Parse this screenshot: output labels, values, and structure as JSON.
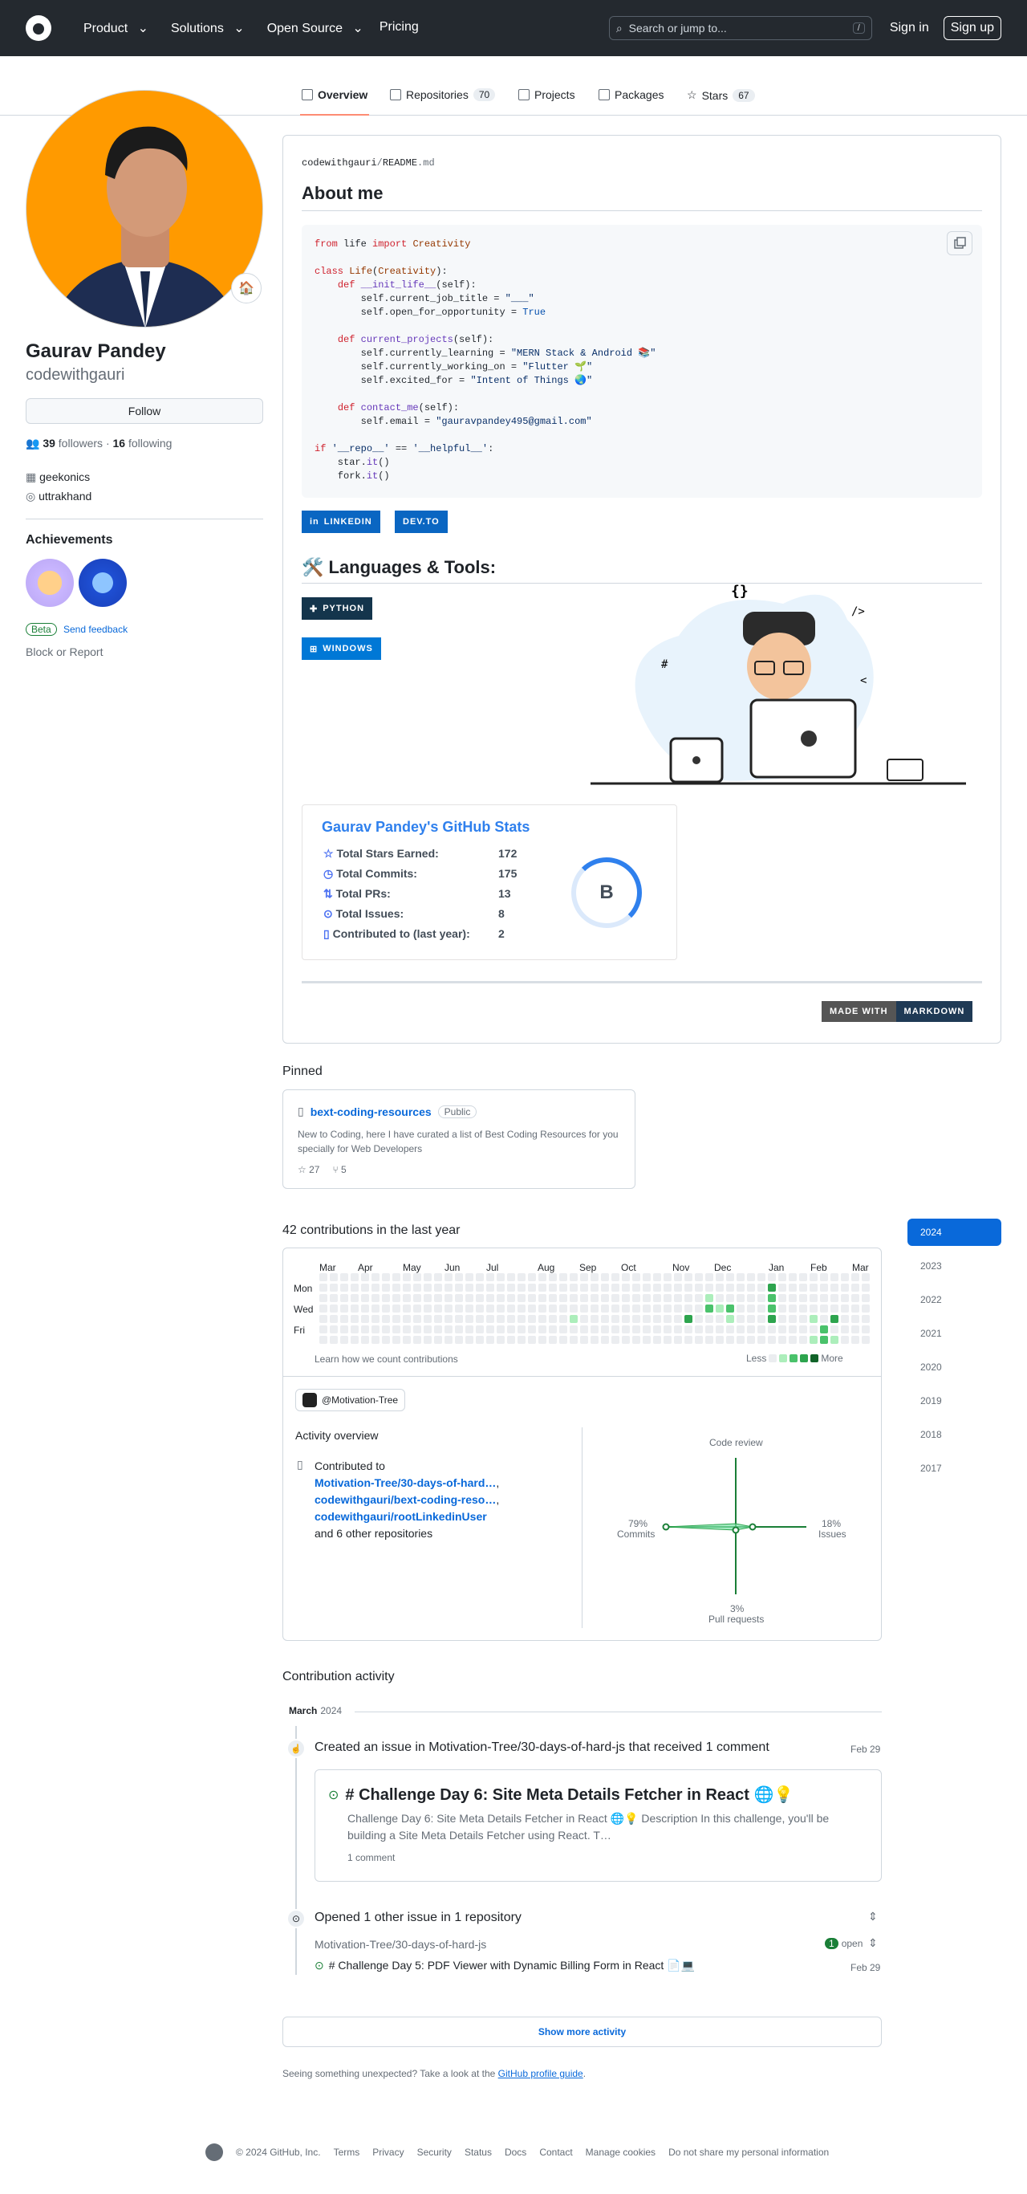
{
  "header": {
    "nav": [
      "Product",
      "Solutions",
      "Open Source",
      "Pricing"
    ],
    "search_placeholder": "Search or jump to...",
    "slash": "/",
    "signin": "Sign in",
    "signup": "Sign up"
  },
  "tabs": [
    {
      "label": "Overview"
    },
    {
      "label": "Repositories",
      "count": "70"
    },
    {
      "label": "Projects"
    },
    {
      "label": "Packages"
    },
    {
      "label": "Stars",
      "count": "67"
    }
  ],
  "profile": {
    "name": "Gaurav Pandey",
    "login": "codewithgauri",
    "follow": "Follow",
    "followers": "39",
    "followers_label": "followers",
    "sep": "·",
    "following": "16",
    "following_label": "following",
    "org": "geekonics",
    "location": "uttrakhand",
    "achievements": "Achievements",
    "beta": "Beta",
    "feedback": "Send feedback",
    "block": "Block or Report"
  },
  "readme": {
    "path_user": "codewithgauri",
    "path_sep": "/",
    "path_file": "README",
    "path_ext": ".md",
    "title": "About me",
    "tools_title": "🛠️ Languages & Tools:"
  },
  "shields": {
    "linkedin": "LINKEDIN",
    "devto": "DEV.TO",
    "python": "PYTHON",
    "windows": "WINDOWS",
    "made": "MADE WITH",
    "markdown": "MARKDOWN"
  },
  "stats": {
    "title": "Gaurav Pandey's GitHub Stats",
    "rows": [
      {
        "label": "Total Stars Earned:",
        "value": "172"
      },
      {
        "label": "Total Commits:",
        "value": "175"
      },
      {
        "label": "Total PRs:",
        "value": "13"
      },
      {
        "label": "Total Issues:",
        "value": "8"
      },
      {
        "label": "Contributed to (last year):",
        "value": "2"
      }
    ],
    "grade": "B"
  },
  "pinned": {
    "title": "Pinned",
    "repo": "bext-coding-resources",
    "visibility": "Public",
    "desc": "New to Coding, here I have curated a list of Best Coding Resources for you specially for Web Developers",
    "stars": "27",
    "forks": "5"
  },
  "contrib": {
    "title": "42 contributions in the last year",
    "months": [
      "Mar",
      "Apr",
      "May",
      "Jun",
      "Jul",
      "Aug",
      "Sep",
      "Oct",
      "Nov",
      "Dec",
      "Jan",
      "Feb",
      "Mar"
    ],
    "days": [
      "Mon",
      "Wed",
      "Fri"
    ],
    "learn": "Learn how we count contributions",
    "less": "Less",
    "more": "More",
    "org": "@Motivation-Tree",
    "overview": "Activity overview",
    "contributed_to": "Contributed to",
    "repos": [
      "Motivation-Tree/30-days-of-hard…",
      "codewithgauri/bext-coding-reso…",
      "codewithgauri/rootLinkedinUser"
    ],
    "comma": ",",
    "others": "and 6 other repositories",
    "radar": {
      "code_review": "Code review",
      "commits_pct": "79%",
      "commits": "Commits",
      "issues_pct": "18%",
      "issues": "Issues",
      "pr_pct": "3%",
      "pr": "Pull requests"
    }
  },
  "years": [
    "2024",
    "2023",
    "2022",
    "2021",
    "2020",
    "2019",
    "2018",
    "2017"
  ],
  "activity": {
    "title": "Contribution activity",
    "month": "March",
    "year": "2024",
    "event1": "Created an issue in Motivation-Tree/30-days-of-hard-js that received 1 comment",
    "event1_date": "Feb 29",
    "issue_title": "# Challenge Day 6: Site Meta Details Fetcher in React 🌐💡",
    "issue_body": "Challenge Day 6: Site Meta Details Fetcher in React 🌐💡 Description In this challenge, you'll be building a Site Meta Details Fetcher using React. T…",
    "issue_comments": "1 comment",
    "event2": "Opened 1 other issue in 1 repository",
    "event2_repo": "Motivation-Tree/30-days-of-hard-js",
    "open_count": "1",
    "open_label": "open",
    "issue2": "# Challenge Day 5: PDF Viewer with Dynamic Billing Form in React 📄💻",
    "issue2_date": "Feb 29",
    "show_more": "Show more activity",
    "unexpected": "Seeing something unexpected? Take a look at the",
    "guide": "GitHub profile guide",
    "dot": "."
  },
  "footer": {
    "copy": "© 2024 GitHub, Inc.",
    "links": [
      "Terms",
      "Privacy",
      "Security",
      "Status",
      "Docs",
      "Contact",
      "Manage cookies",
      "Do not share my personal information"
    ]
  },
  "levels": {
    "1": [],
    "2": []
  }
}
